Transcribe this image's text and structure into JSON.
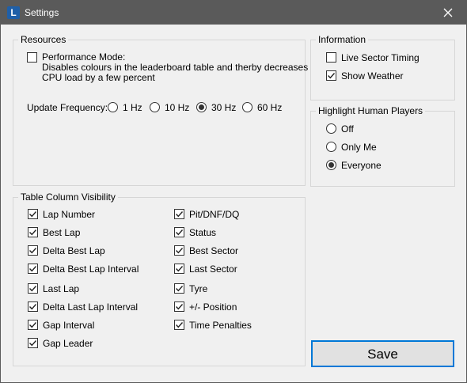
{
  "window": {
    "title": "Settings",
    "app_icon_letter": "L"
  },
  "resources": {
    "legend": "Resources",
    "performance_mode": {
      "label_line1": "Performance Mode:",
      "label_line2": "Disables colours in the leaderboard table and therby decreases",
      "label_line3": "CPU load by a few percent",
      "checked": false
    },
    "update_frequency": {
      "label": "Update Frequency:",
      "options": [
        "1 Hz",
        "10 Hz",
        "30 Hz",
        "60 Hz"
      ],
      "selected": "30 Hz"
    }
  },
  "information": {
    "legend": "Information",
    "items": [
      {
        "label": "Live Sector Timing",
        "checked": false
      },
      {
        "label": "Show Weather",
        "checked": true
      }
    ]
  },
  "highlight": {
    "legend": "Highlight Human Players",
    "options": [
      "Off",
      "Only Me",
      "Everyone"
    ],
    "selected": "Everyone"
  },
  "columns": {
    "legend": "Table Column Visibility",
    "left": [
      {
        "label": "Lap Number",
        "checked": true
      },
      {
        "label": "Best Lap",
        "checked": true
      },
      {
        "label": "Delta Best Lap",
        "checked": true
      },
      {
        "label": "Delta Best Lap Interval",
        "checked": true
      },
      {
        "label": "Last Lap",
        "checked": true
      },
      {
        "label": "Delta Last Lap Interval",
        "checked": true
      },
      {
        "label": "Gap Interval",
        "checked": true
      },
      {
        "label": "Gap Leader",
        "checked": true
      }
    ],
    "right": [
      {
        "label": "Pit/DNF/DQ",
        "checked": true
      },
      {
        "label": "Status",
        "checked": true
      },
      {
        "label": "Best Sector",
        "checked": true
      },
      {
        "label": "Last Sector",
        "checked": true
      },
      {
        "label": "Tyre",
        "checked": true
      },
      {
        "label": "+/- Position",
        "checked": true
      },
      {
        "label": "Time Penalties",
        "checked": true
      }
    ]
  },
  "save_label": "Save",
  "colors": {
    "titlebar": "#5a5a5a",
    "accent": "#0078d7",
    "background": "#f0f0f0"
  },
  "icons": {
    "app": "app-logo-icon",
    "close": "close-icon",
    "check": "checkmark-icon"
  }
}
